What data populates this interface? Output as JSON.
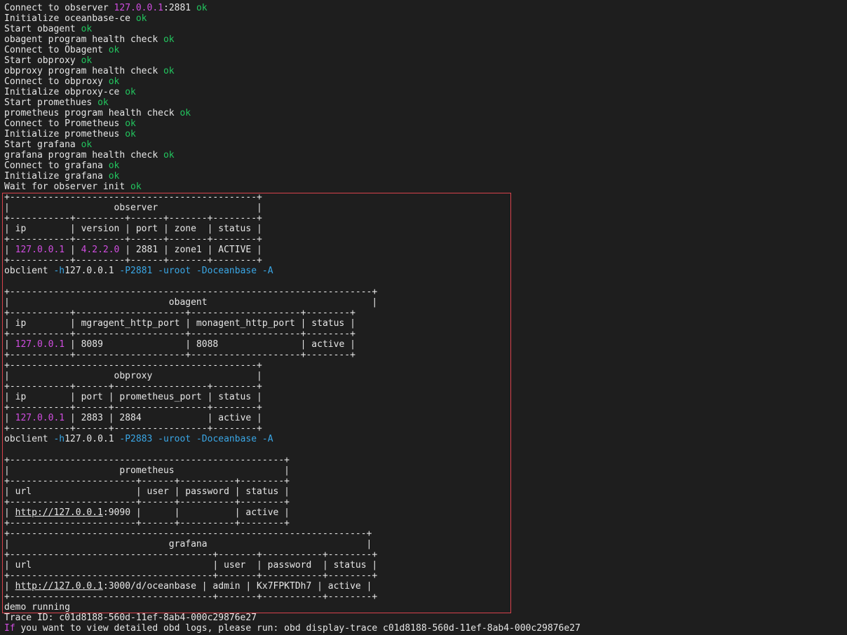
{
  "colors": {
    "background": "#1e1e1e",
    "text": "#e6e6e6",
    "ok": "#22c55e",
    "ip": "#d04de0",
    "flag": "#3aa7e6",
    "highlight_box": "#d9434c"
  },
  "log": [
    {
      "text": "Connect to observer ",
      "ip": "127.0.0.1",
      "suffix": ":2881",
      "ok": "ok"
    },
    {
      "text": "Initialize oceanbase-ce ",
      "ok": "ok"
    },
    {
      "text": "Start obagent ",
      "ok": "ok"
    },
    {
      "text": "obagent program health check ",
      "ok": "ok"
    },
    {
      "text": "Connect to Obagent ",
      "ok": "ok"
    },
    {
      "text": "Start obproxy ",
      "ok": "ok"
    },
    {
      "text": "obproxy program health check ",
      "ok": "ok"
    },
    {
      "text": "Connect to obproxy ",
      "ok": "ok"
    },
    {
      "text": "Initialize obproxy-ce ",
      "ok": "ok"
    },
    {
      "text": "Start promethues ",
      "ok": "ok"
    },
    {
      "text": "prometheus program health check ",
      "ok": "ok"
    },
    {
      "text": "Connect to Prometheus ",
      "ok": "ok"
    },
    {
      "text": "Initialize prometheus ",
      "ok": "ok"
    },
    {
      "text": "Start grafana ",
      "ok": "ok"
    },
    {
      "text": "grafana program health check ",
      "ok": "ok"
    },
    {
      "text": "Connect to grafana ",
      "ok": "ok"
    },
    {
      "text": "Initialize grafana ",
      "ok": "ok"
    },
    {
      "text": "Wait for observer init ",
      "ok": "ok"
    }
  ],
  "observer": {
    "border": "+---------------------------------------------+",
    "title": "|                   observer                  |",
    "sep": "+-----------+---------+------+-------+--------+",
    "header": "| ip        | version | port | zone  | status |",
    "row": {
      "ip": "127.0.0.1",
      "version": "4.2.2.0",
      "rest": " | 2881 | zone1 | ACTIVE |"
    },
    "obclient": {
      "cmd": "obclient ",
      "h": "-h",
      "host": "127.0.0.1",
      "args": " -P2881 -uroot -Doceanbase -A"
    }
  },
  "obagent": {
    "border": "+------------------------------------------------------------------+",
    "title": "|                             obagent                              |",
    "sep": "+-----------+--------------------+--------------------+--------+",
    "header": "| ip        | mgragent_http_port | monagent_http_port | status |",
    "row": {
      "ip": "127.0.0.1",
      "rest": " | 8089               | 8088               | active |"
    }
  },
  "obproxy": {
    "border": "+---------------------------------------------+",
    "title": "|                   obproxy                   |",
    "sep": "+-----------+------+-----------------+--------+",
    "header": "| ip        | port | prometheus_port | status |",
    "row": {
      "ip": "127.0.0.1",
      "rest": " | 2883 | 2884            | active |"
    },
    "obclient": {
      "cmd": "obclient ",
      "h": "-h",
      "host": "127.0.0.1",
      "args": " -P2883 -uroot -Doceanbase -A"
    }
  },
  "prometheus": {
    "border": "+--------------------------------------------------+",
    "title": "|                    prometheus                    |",
    "sep": "+-----------------------+------+----------+--------+",
    "header": "| url                   | user | password | status |",
    "row": {
      "url": "http://127.0.0.1",
      "rest": ":9090 |      |          | active |"
    }
  },
  "grafana": {
    "border": "+-----------------------------------------------------------------+",
    "title": "|                             grafana                             |",
    "sep": "+-------------------------------------+-------+-----------+--------+",
    "header": "| url                                 | user  | password  | status |",
    "row": {
      "url": "http://127.0.0.1",
      "rest": ":3000/d/oceanbase | admin | Kx7FPKTDh7 | active |"
    }
  },
  "footer": {
    "status": "demo running",
    "trace": "Trace ID: c01d8188-560d-11ef-8ab4-000c29876e27",
    "hint_prefix": "If",
    "hint": " you want to view detailed obd logs, please run: obd display-trace c01d8188-560d-11ef-8ab4-000c29876e27"
  }
}
